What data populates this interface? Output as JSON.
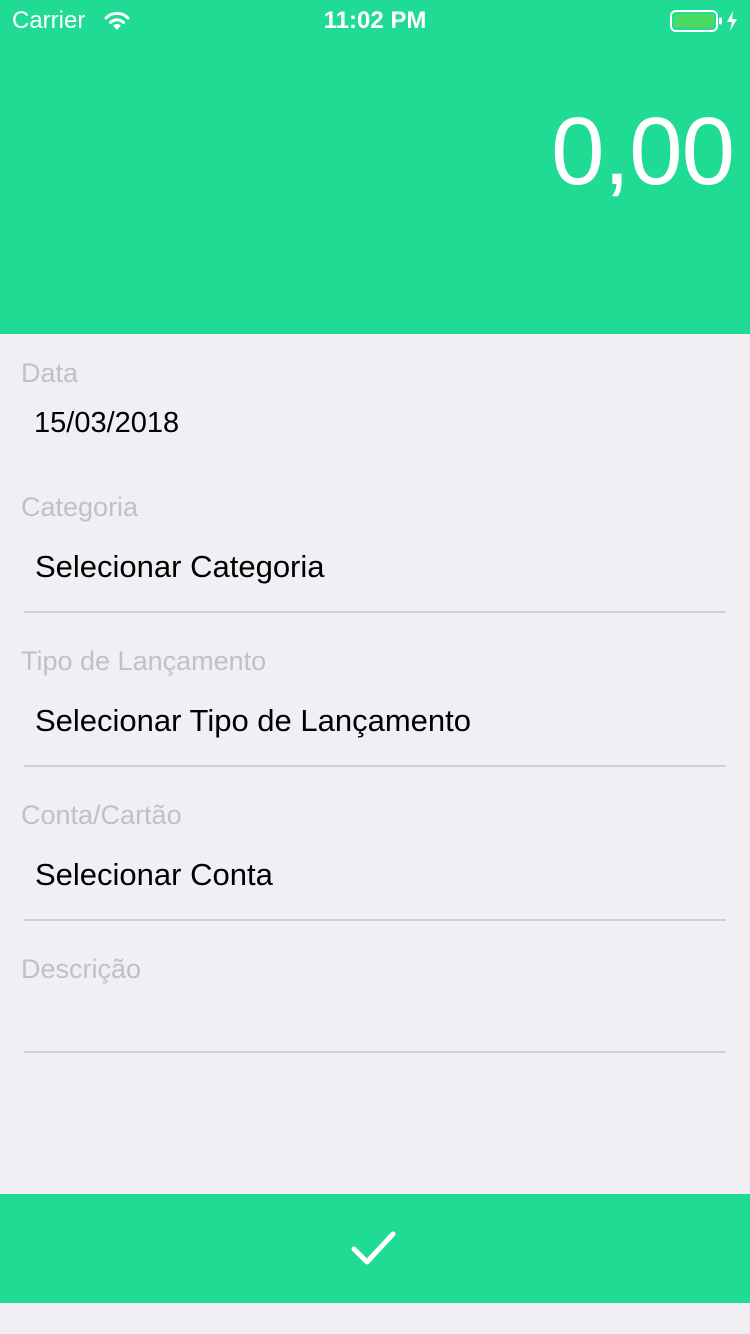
{
  "status_bar": {
    "carrier": "Carrier",
    "time": "11:02 PM",
    "wifi_icon": "wifi-icon",
    "battery_icon": "battery-charging-icon"
  },
  "header": {
    "amount": "0,00",
    "background_color": "#1fdb93"
  },
  "form": {
    "date_label": "Data",
    "date_value": "15/03/2018",
    "category_label": "Categoria",
    "category_value": "Selecionar Categoria",
    "entry_type_label": "Tipo de Lançamento",
    "entry_type_value": "Selecionar Tipo de Lançamento",
    "account_label": "Conta/Cartão",
    "account_value": "Selecionar Conta",
    "description_label": "Descrição",
    "description_value": ""
  },
  "footer": {
    "confirm_icon": "checkmark-icon"
  },
  "colors": {
    "accent": "#1fdb93",
    "background": "#efeff4",
    "label": "#c0c0c6",
    "divider": "#cfcfd3"
  }
}
